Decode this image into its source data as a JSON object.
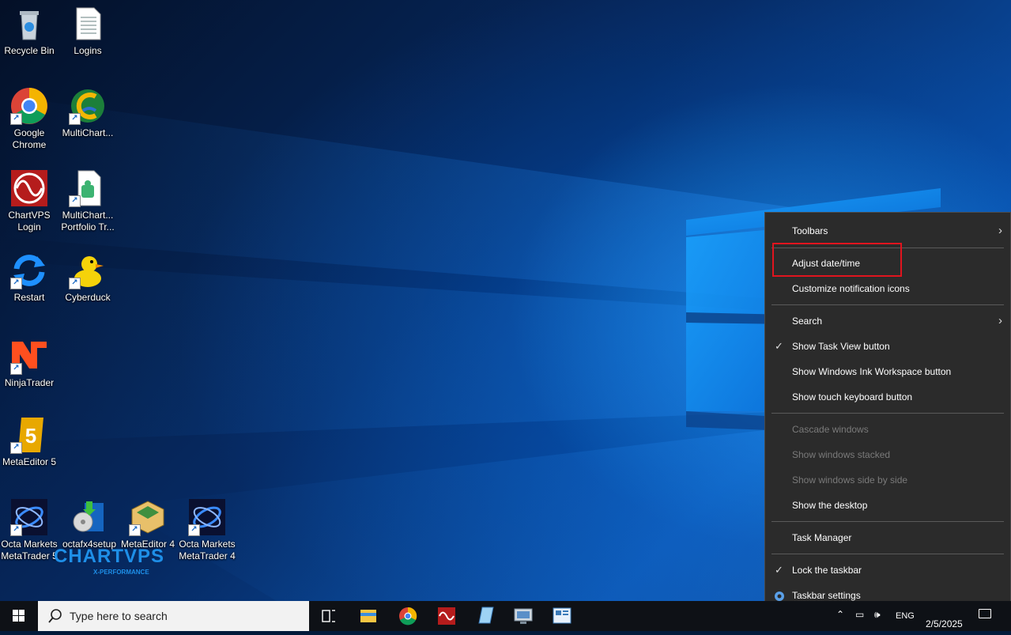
{
  "desktop": {
    "icons": [
      {
        "label": "Recycle Bin"
      },
      {
        "label": "Logins"
      },
      {
        "label": "Google Chrome"
      },
      {
        "label": "MultiChart..."
      },
      {
        "label": "ChartVPS Login"
      },
      {
        "label": "MultiChart... Portfolio Tr..."
      },
      {
        "label": "Restart"
      },
      {
        "label": "Cyberduck"
      },
      {
        "label": "NinjaTrader"
      },
      {
        "label": "MetaEditor 5"
      },
      {
        "label": "Octa Markets MetaTrader 5"
      },
      {
        "label": "octafx4setup"
      },
      {
        "label": "MetaEditor 4"
      },
      {
        "label": "Octa Markets MetaTrader 4"
      }
    ],
    "watermark": {
      "brand": "CHARTVPS",
      "tagline": "X-PERFORMANCE"
    }
  },
  "context_menu": {
    "items": [
      {
        "label": "Toolbars",
        "submenu": true
      },
      {
        "label": "Adjust date/time",
        "highlighted": true
      },
      {
        "label": "Customize notification icons"
      },
      {
        "label": "Search",
        "submenu": true
      },
      {
        "label": "Show Task View button",
        "checked": true
      },
      {
        "label": "Show Windows Ink Workspace button"
      },
      {
        "label": "Show touch keyboard button"
      },
      {
        "label": "Cascade windows",
        "disabled": true
      },
      {
        "label": "Show windows stacked",
        "disabled": true
      },
      {
        "label": "Show windows side by side",
        "disabled": true
      },
      {
        "label": "Show the desktop"
      },
      {
        "label": "Task Manager"
      },
      {
        "label": "Lock the taskbar",
        "checked": true
      },
      {
        "label": "Taskbar settings",
        "icon": "gear-icon"
      }
    ],
    "highlight_color": "#e0141e"
  },
  "taskbar": {
    "search_placeholder": "Type here to search",
    "pinned": [
      "task-view-icon",
      "file-explorer-icon",
      "chrome-icon",
      "chartvps-icon",
      "notepad-icon",
      "remote-desktop-icon",
      "control-panel-icon"
    ],
    "tray": {
      "language": "ENG",
      "date": "2/5/2025"
    }
  }
}
